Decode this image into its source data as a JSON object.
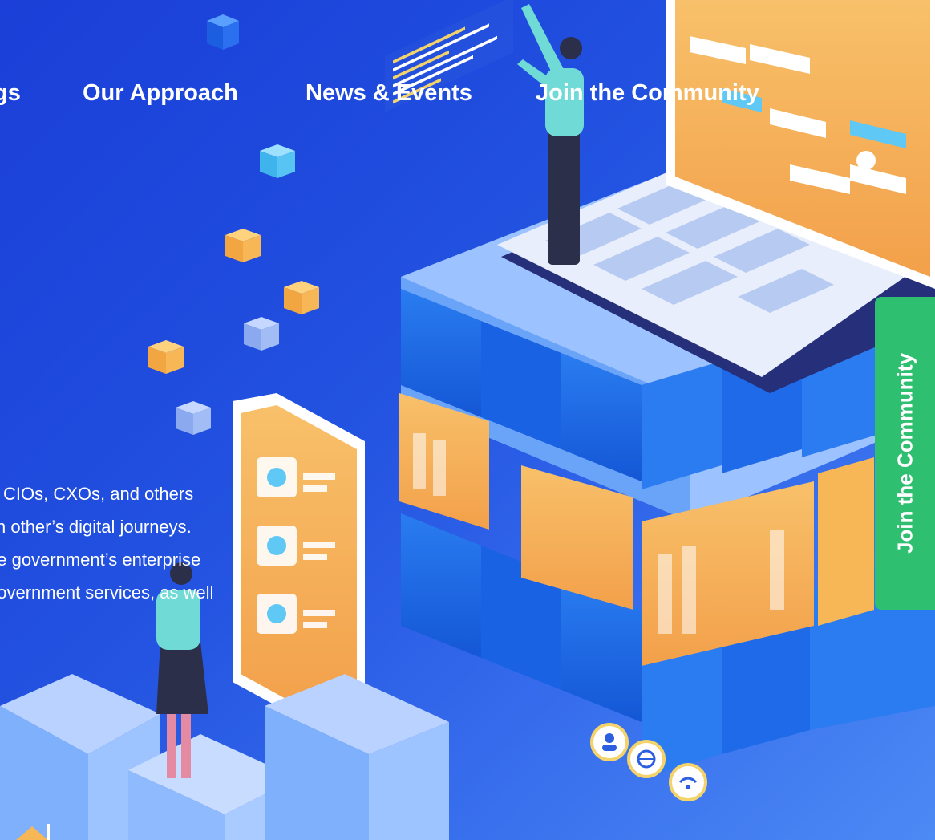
{
  "nav": {
    "items": [
      {
        "label": "gs"
      },
      {
        "label": "Our Approach"
      },
      {
        "label": "News & Events"
      },
      {
        "label": "Join the Community"
      }
    ]
  },
  "intro": {
    "lines": [
      "CIOs, CXOs, and others",
      "ch other’s digital journeys.",
      "he government’s enterprise",
      "government services, as well"
    ]
  },
  "side_tab": {
    "label": "Join the Community"
  },
  "colors": {
    "background": "#1e4fe0",
    "accent_green": "#2fbf71",
    "orange": "#f5a94e",
    "cube_blue": "#1f6fe8"
  },
  "icons": [
    "user-icon",
    "globe-icon",
    "wifi-icon"
  ]
}
